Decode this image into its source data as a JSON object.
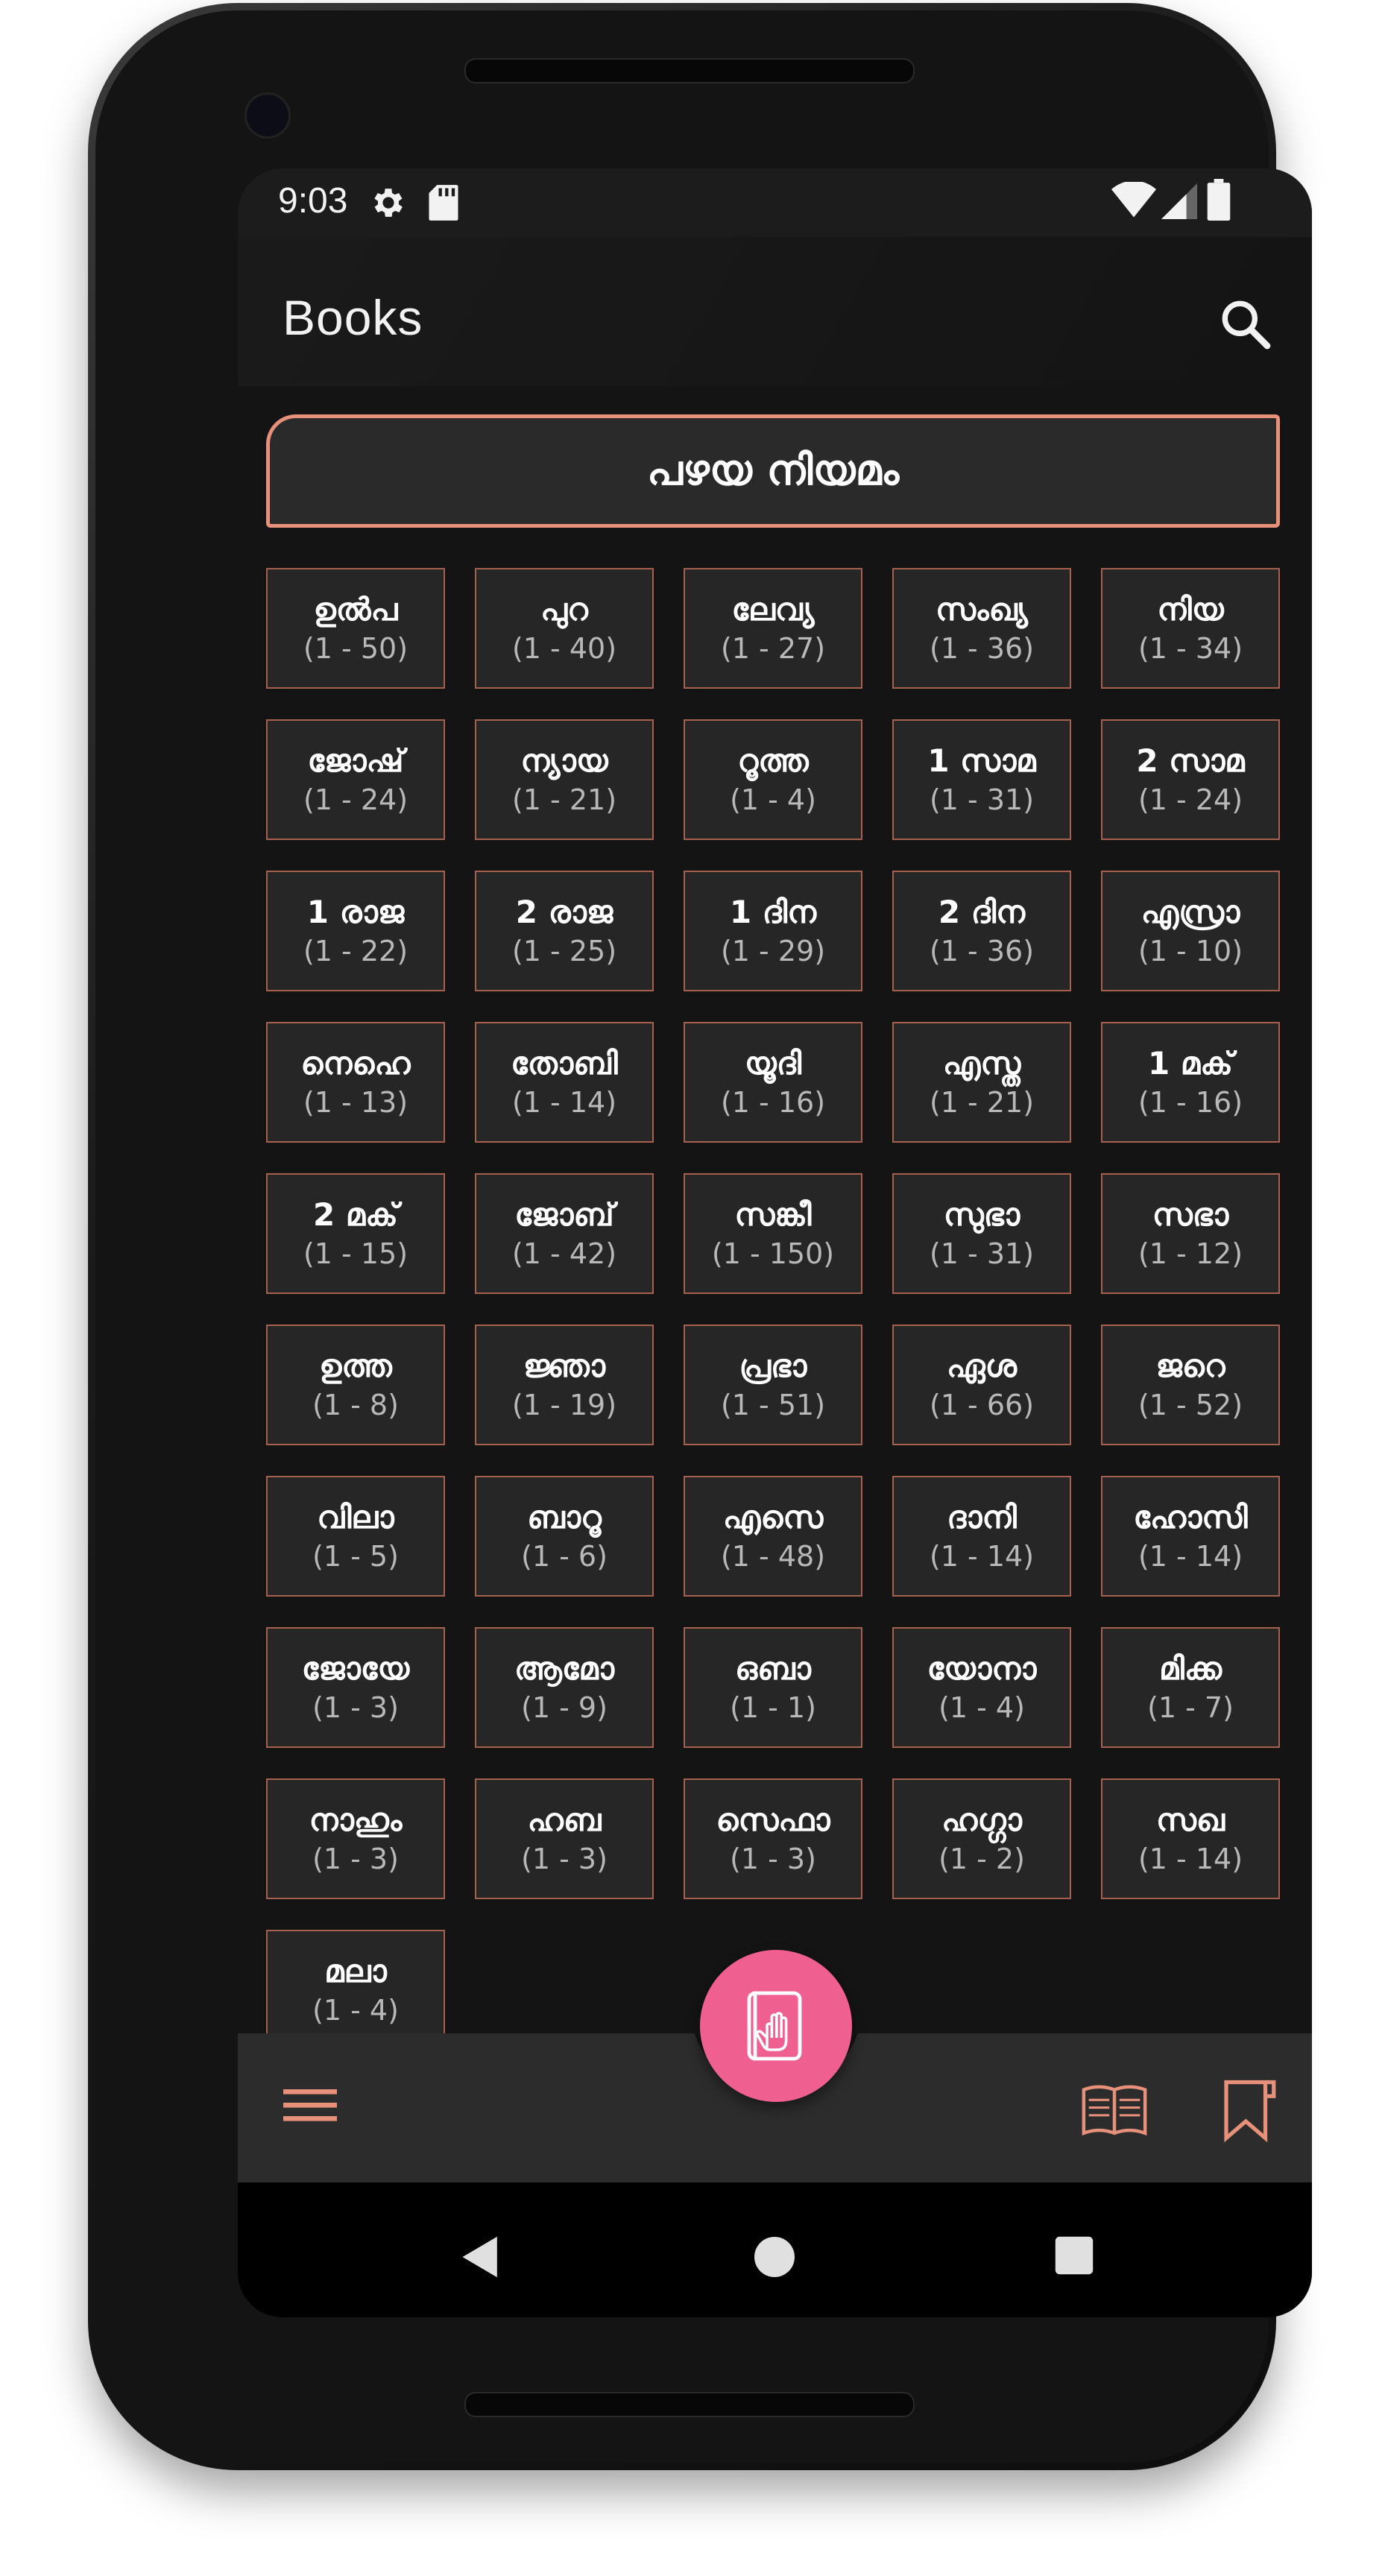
{
  "status_bar": {
    "time": "9:03",
    "left_icons": [
      "gear-icon",
      "sd-card-icon"
    ],
    "right_icons": [
      "wifi-icon",
      "signal-icon",
      "battery-icon"
    ]
  },
  "app_bar": {
    "title": "Books",
    "search_icon": "search-icon"
  },
  "section": {
    "title": "പഴയ നിയമം"
  },
  "books": [
    {
      "abbr": "ഉൽപ",
      "range": "(1 - 50)"
    },
    {
      "abbr": "പുറ",
      "range": "(1 - 40)"
    },
    {
      "abbr": "ലേവ്യ",
      "range": "(1 - 27)"
    },
    {
      "abbr": "സംഖ്യ",
      "range": "(1 - 36)"
    },
    {
      "abbr": "നിയ",
      "range": "(1 - 34)"
    },
    {
      "abbr": "ജോഷ്",
      "range": "(1 - 24)"
    },
    {
      "abbr": "ന്യായ",
      "range": "(1 - 21)"
    },
    {
      "abbr": "റൂത്ത",
      "range": "(1 - 4)"
    },
    {
      "abbr": "1 സാമ",
      "range": "(1 - 31)"
    },
    {
      "abbr": "2 സാമ",
      "range": "(1 - 24)"
    },
    {
      "abbr": "1 രാജ",
      "range": "(1 - 22)"
    },
    {
      "abbr": "2 രാജ",
      "range": "(1 - 25)"
    },
    {
      "abbr": "1 ദിന",
      "range": "(1 - 29)"
    },
    {
      "abbr": "2 ദിന",
      "range": "(1 - 36)"
    },
    {
      "abbr": "എസ്രാ",
      "range": "(1 - 10)"
    },
    {
      "abbr": "നെഹെ",
      "range": "(1 - 13)"
    },
    {
      "abbr": "തോബി",
      "range": "(1 - 14)"
    },
    {
      "abbr": "യൂദി",
      "range": "(1 - 16)"
    },
    {
      "abbr": "എസ്ത",
      "range": "(1 - 21)"
    },
    {
      "abbr": "1 മക്",
      "range": "(1 - 16)"
    },
    {
      "abbr": "2 മക്",
      "range": "(1 - 15)"
    },
    {
      "abbr": "ജോബ്",
      "range": "(1 - 42)"
    },
    {
      "abbr": "സങ്കീ",
      "range": "(1 - 150)"
    },
    {
      "abbr": "സുഭാ",
      "range": "(1 - 31)"
    },
    {
      "abbr": "സഭാ",
      "range": "(1 - 12)"
    },
    {
      "abbr": "ഉത്ത",
      "range": "(1 - 8)"
    },
    {
      "abbr": "ജ്ഞാ",
      "range": "(1 - 19)"
    },
    {
      "abbr": "പ്രഭാ",
      "range": "(1 - 51)"
    },
    {
      "abbr": "ഏശ",
      "range": "(1 - 66)"
    },
    {
      "abbr": "ജറെ",
      "range": "(1 - 52)"
    },
    {
      "abbr": "വിലാ",
      "range": "(1 - 5)"
    },
    {
      "abbr": "ബാറൂ",
      "range": "(1 - 6)"
    },
    {
      "abbr": "എസെ",
      "range": "(1 - 48)"
    },
    {
      "abbr": "ദാനി",
      "range": "(1 - 14)"
    },
    {
      "abbr": "ഹോസി",
      "range": "(1 - 14)"
    },
    {
      "abbr": "ജോയേ",
      "range": "(1 - 3)"
    },
    {
      "abbr": "ആമോ",
      "range": "(1 - 9)"
    },
    {
      "abbr": "ഒബാ",
      "range": "(1 - 1)"
    },
    {
      "abbr": "യോനാ",
      "range": "(1 - 4)"
    },
    {
      "abbr": "മിക്ക",
      "range": "(1 - 7)"
    },
    {
      "abbr": "നാഹും",
      "range": "(1 - 3)"
    },
    {
      "abbr": "ഹബ",
      "range": "(1 - 3)"
    },
    {
      "abbr": "സെഫാ",
      "range": "(1 - 3)"
    },
    {
      "abbr": "ഹഗ്ഗാ",
      "range": "(1 - 2)"
    },
    {
      "abbr": "സഖ",
      "range": "(1 - 14)"
    },
    {
      "abbr": "മലാ",
      "range": "(1 - 4)"
    }
  ],
  "bottom_bar": {
    "left_icon": "menu-icon",
    "fab_icon": "bible-hand-icon",
    "right_icons": [
      "open-book-icon",
      "bookmark-icon"
    ]
  },
  "nav_bar": {
    "icons": [
      "back-icon",
      "home-icon",
      "recents-icon"
    ]
  },
  "colors": {
    "accent": "#e8917a",
    "fab": "#ef5f8f",
    "background": "#141414",
    "tile_border": "#a8604e"
  }
}
